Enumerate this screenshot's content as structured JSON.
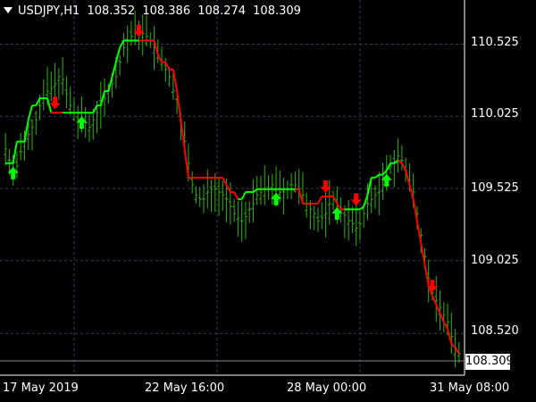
{
  "header": {
    "symbol_timeframe": "USDJPY,H1",
    "open": "108.352",
    "high": "108.386",
    "low": "108.274",
    "close": "108.309"
  },
  "price_axis": {
    "labels": [
      "110.525",
      "110.025",
      "109.525",
      "109.025",
      "108.520"
    ],
    "current_price": "108.309"
  },
  "time_axis": {
    "labels": [
      "17 May 2019",
      "22 May 16:00",
      "28 May 00:00",
      "31 May 08:00"
    ]
  },
  "colors": {
    "background": "#000000",
    "candles": "#2db400",
    "line_up": "#00ff00",
    "line_down": "#ff0000",
    "arrow_up": "#00ff00",
    "arrow_down": "#ff0000",
    "grid": "#3a3a60"
  },
  "chart_data": {
    "type": "line",
    "ylim": [
      108.28,
      110.72
    ],
    "x_count": 120,
    "y_ticks": [
      110.525,
      110.025,
      109.525,
      109.025,
      108.52
    ],
    "current_price": 108.309,
    "series": [
      {
        "values": [
          109.8,
          109.72,
          109.7,
          109.68,
          109.78,
          109.85,
          109.9,
          109.95,
          110.0,
          110.1,
          110.15,
          110.2,
          110.22,
          110.25,
          110.3,
          110.28,
          110.18,
          110.1,
          110.05,
          110.0,
          110.0,
          109.98,
          109.95,
          110.0,
          110.05,
          110.1,
          110.15,
          110.2,
          110.25,
          110.3,
          110.4,
          110.5,
          110.55,
          110.58,
          110.6,
          110.62,
          110.6,
          110.58,
          110.55,
          110.5,
          110.45,
          110.4,
          110.35,
          110.3,
          110.2,
          110.15,
          110.0,
          109.85,
          109.7,
          109.55,
          109.48,
          109.45,
          109.45,
          109.5,
          109.52,
          109.52,
          109.5,
          109.48,
          109.45,
          109.4,
          109.35,
          109.32,
          109.3,
          109.33,
          109.38,
          109.42,
          109.48,
          109.5,
          109.52,
          109.52,
          109.55,
          109.52,
          109.5,
          109.5,
          109.52,
          109.55,
          109.55,
          109.52,
          109.48,
          109.42,
          109.38,
          109.35,
          109.3,
          109.32,
          109.35,
          109.42,
          109.45,
          109.4,
          109.38,
          109.34,
          109.3,
          109.28,
          109.25,
          109.28,
          109.35,
          109.42,
          109.45,
          109.48,
          109.5,
          109.55,
          109.6,
          109.68,
          109.7,
          109.75,
          109.72,
          109.65,
          109.58,
          109.5,
          109.35,
          109.2,
          109.05,
          108.9,
          108.8,
          108.75,
          108.7,
          108.65,
          108.6,
          108.5,
          108.42,
          108.38
        ]
      }
    ],
    "indicator_line": {
      "values": [
        109.7,
        109.7,
        109.7,
        109.85,
        109.85,
        109.85,
        110.0,
        110.1,
        110.1,
        110.15,
        110.15,
        110.15,
        110.05,
        110.05,
        110.05,
        110.05,
        110.05,
        110.05,
        110.05,
        110.05,
        110.05,
        110.05,
        110.05,
        110.05,
        110.1,
        110.1,
        110.2,
        110.2,
        110.3,
        110.4,
        110.5,
        110.55,
        110.55,
        110.55,
        110.55,
        110.55,
        110.55,
        110.55,
        110.55,
        110.55,
        110.45,
        110.4,
        110.4,
        110.35,
        110.35,
        110.2,
        110.0,
        109.8,
        109.6,
        109.6,
        109.6,
        109.6,
        109.6,
        109.6,
        109.6,
        109.6,
        109.6,
        109.6,
        109.55,
        109.5,
        109.5,
        109.45,
        109.45,
        109.5,
        109.5,
        109.5,
        109.52,
        109.52,
        109.52,
        109.52,
        109.52,
        109.52,
        109.52,
        109.52,
        109.52,
        109.52,
        109.52,
        109.52,
        109.42,
        109.42,
        109.42,
        109.42,
        109.42,
        109.47,
        109.47,
        109.47,
        109.47,
        109.42,
        109.38,
        109.38,
        109.38,
        109.38,
        109.38,
        109.38,
        109.4,
        109.48,
        109.6,
        109.6,
        109.62,
        109.62,
        109.65,
        109.7,
        109.7,
        109.72,
        109.7,
        109.65,
        109.55,
        109.45,
        109.3,
        109.15,
        109.0,
        108.85,
        108.78,
        108.72,
        108.66,
        108.6,
        108.55,
        108.45,
        108.42,
        108.38
      ],
      "direction": [
        "up",
        "up",
        "up",
        "up",
        "up",
        "up",
        "up",
        "up",
        "up",
        "up",
        "up",
        "up",
        "up",
        "down",
        "down",
        "down",
        "up",
        "up",
        "up",
        "up",
        "up",
        "up",
        "up",
        "up",
        "up",
        "up",
        "up",
        "up",
        "up",
        "up",
        "up",
        "up",
        "up",
        "up",
        "up",
        "up",
        "down",
        "down",
        "down",
        "down",
        "down",
        "down",
        "down",
        "down",
        "down",
        "down",
        "down",
        "down",
        "down",
        "down",
        "down",
        "down",
        "down",
        "down",
        "down",
        "down",
        "down",
        "down",
        "down",
        "down",
        "down",
        "down",
        "up",
        "up",
        "up",
        "up",
        "up",
        "up",
        "up",
        "up",
        "up",
        "up",
        "up",
        "up",
        "up",
        "up",
        "up",
        "down",
        "down",
        "down",
        "down",
        "down",
        "down",
        "down",
        "down",
        "down",
        "down",
        "down",
        "down",
        "down",
        "up",
        "up",
        "up",
        "up",
        "up",
        "up",
        "up",
        "up",
        "up",
        "up",
        "up",
        "up",
        "up",
        "up",
        "down",
        "down",
        "down",
        "down",
        "down",
        "down",
        "down",
        "down",
        "down",
        "down",
        "down",
        "down",
        "down",
        "down",
        "down",
        "down"
      ]
    },
    "arrows": [
      {
        "index": 2,
        "dir": "up"
      },
      {
        "index": 13,
        "dir": "down"
      },
      {
        "index": 20,
        "dir": "up"
      },
      {
        "index": 35,
        "dir": "down"
      },
      {
        "index": 71,
        "dir": "up"
      },
      {
        "index": 84,
        "dir": "down"
      },
      {
        "index": 87,
        "dir": "up"
      },
      {
        "index": 92,
        "dir": "down"
      },
      {
        "index": 100,
        "dir": "up"
      },
      {
        "index": 112,
        "dir": "down"
      }
    ]
  }
}
